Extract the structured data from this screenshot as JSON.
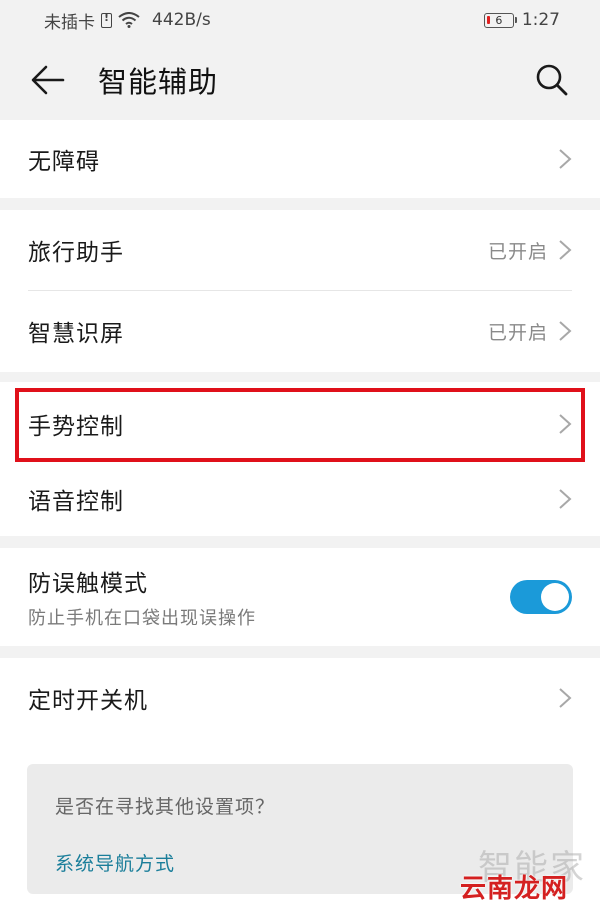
{
  "status_bar": {
    "carrier": "未插卡",
    "network_speed": "442B/s",
    "battery_level": "6",
    "time": "1:27"
  },
  "header": {
    "title": "智能辅助",
    "back_icon": "arrow-left-icon",
    "search_icon": "search-icon"
  },
  "settings": {
    "accessibility": {
      "label": "无障碍"
    },
    "travel_assistant": {
      "label": "旅行助手",
      "value": "已开启"
    },
    "smart_screen": {
      "label": "智慧识屏",
      "value": "已开启"
    },
    "gesture_control": {
      "label": "手势控制"
    },
    "voice_control": {
      "label": "语音控制"
    },
    "pocket_mode": {
      "label": "防误触模式",
      "description": "防止手机在口袋出现误操作",
      "enabled": true
    },
    "scheduled_power": {
      "label": "定时开关机"
    }
  },
  "suggestion": {
    "question": "是否在寻找其他设置项？",
    "link": "系统导航方式"
  },
  "watermark": {
    "text1": "智能家",
    "text2": "云南龙网"
  },
  "colors": {
    "accent": "#1b9ad9",
    "highlight_border": "#e0101a",
    "link": "#1a7e9a"
  }
}
